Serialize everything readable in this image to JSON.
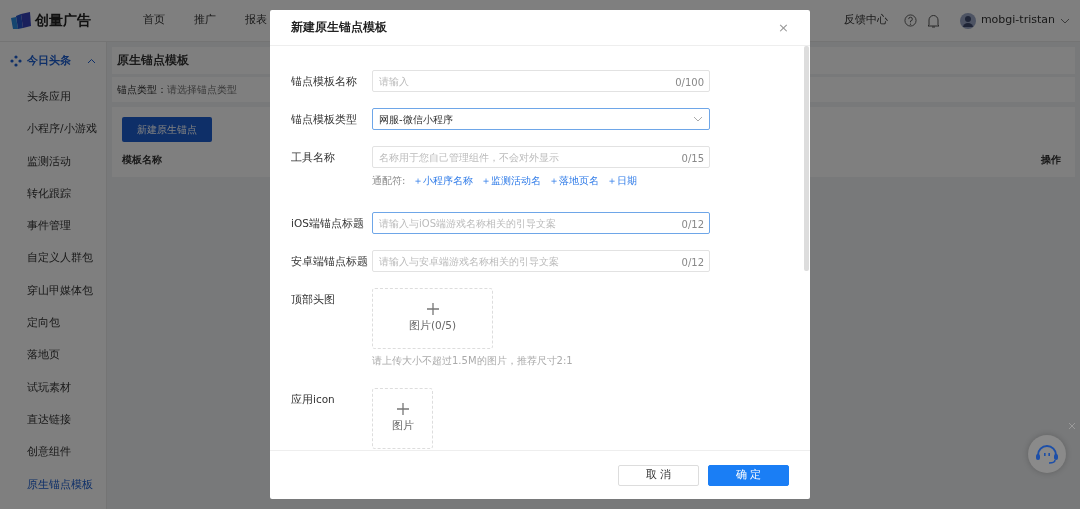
{
  "header": {
    "logo_text": "创量广告",
    "nav": [
      "首页",
      "推广",
      "报表"
    ],
    "feedback": "反馈中心",
    "user": "mobgi-tristan"
  },
  "sidebar": {
    "group": {
      "label": "今日头条",
      "expanded": true
    },
    "items": [
      {
        "label": "头条应用",
        "selected": false
      },
      {
        "label": "小程序/小游戏",
        "selected": false
      },
      {
        "label": "监测活动",
        "selected": false
      },
      {
        "label": "转化跟踪",
        "selected": false
      },
      {
        "label": "事件管理",
        "selected": false
      },
      {
        "label": "自定义人群包",
        "selected": false
      },
      {
        "label": "穿山甲媒体包",
        "selected": false
      },
      {
        "label": "定向包",
        "selected": false
      },
      {
        "label": "落地页",
        "selected": false
      },
      {
        "label": "试玩素材",
        "selected": false
      },
      {
        "label": "直达链接",
        "selected": false
      },
      {
        "label": "创意组件",
        "selected": false
      },
      {
        "label": "原生锚点模板",
        "selected": true
      }
    ]
  },
  "page": {
    "title": "原生锚点模板",
    "filter": {
      "label": "锚点类型：",
      "placeholder": "请选择锚点类型"
    },
    "create_button": "新建原生锚点",
    "table": {
      "columns": [
        "模板名称",
        "操作"
      ]
    }
  },
  "modal": {
    "title": "新建原生锚点模板",
    "close": "×",
    "fields": [
      {
        "kind": "input",
        "label": "锚点模板名称",
        "placeholder": "请输入",
        "counter": "0/100",
        "focused": false
      },
      {
        "kind": "select",
        "label": "锚点模板类型",
        "value": "网服-微信小程序",
        "focused": true
      },
      {
        "kind": "input",
        "label": "工具名称",
        "placeholder": "名称用于您自己管理组件，不会对外显示",
        "counter": "0/15",
        "focused": false,
        "wildcard_label": "通配符:",
        "wildcards": [
          "＋小程序名称",
          "＋监测活动名",
          "＋落地页名",
          "＋日期"
        ]
      },
      {
        "kind": "input",
        "label": "iOS端锚点标题",
        "placeholder": "请输入与iOS端游戏名称相关的引导文案",
        "counter": "0/12",
        "focused": true
      },
      {
        "kind": "input",
        "label": "安卓端锚点标题",
        "placeholder": "请输入与安卓端游戏名称相关的引导文案",
        "counter": "0/12",
        "focused": false
      },
      {
        "kind": "upload",
        "label": "顶部头图",
        "caption": "图片(0/5)",
        "hint": "请上传大小不超过1.5M的图片，推荐尺寸2:1",
        "wide": true
      },
      {
        "kind": "upload",
        "label": "应用icon",
        "caption": "图片",
        "wide": false
      }
    ],
    "buttons": [
      {
        "label": "取 消",
        "primary": false
      },
      {
        "label": "确 定",
        "primary": true
      }
    ]
  }
}
